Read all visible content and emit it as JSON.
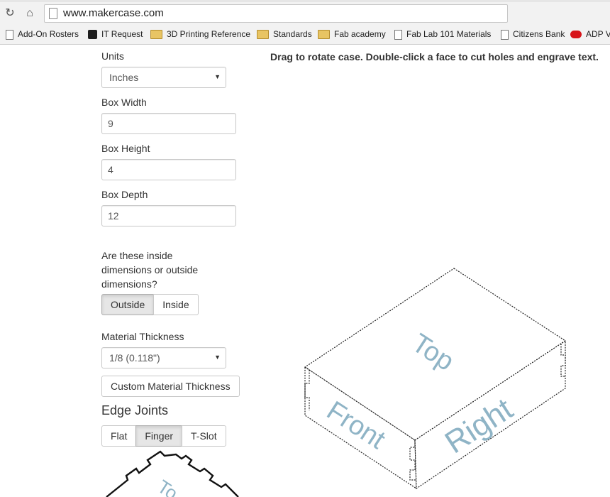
{
  "browser": {
    "url": "www.makercase.com",
    "bookmarks": [
      {
        "label": "Add-On Rosters",
        "icon": "page-icon"
      },
      {
        "label": "IT Request",
        "icon": "it-icon"
      },
      {
        "label": "3D Printing Reference",
        "icon": "folder-icon"
      },
      {
        "label": "Standards",
        "icon": "folder-icon"
      },
      {
        "label": "Fab academy",
        "icon": "folder-icon"
      },
      {
        "label": "Fab Lab 101 Materials",
        "icon": "page-icon"
      },
      {
        "label": "Citizens Bank",
        "icon": "page-icon"
      },
      {
        "label": "ADP Vi",
        "icon": "adp-icon"
      }
    ]
  },
  "form": {
    "units_label": "Units",
    "units_value": "Inches",
    "width_label": "Box Width",
    "width_value": "9",
    "height_label": "Box Height",
    "height_value": "4",
    "depth_label": "Box Depth",
    "depth_value": "12",
    "dimensions_question": "Are these inside dimensions or outside dimensions?",
    "outside_label": "Outside",
    "inside_label": "Inside",
    "selected_dimension": "Outside",
    "thickness_label": "Material Thickness",
    "thickness_value": "1/8 (0.118\")",
    "custom_thickness_label": "Custom Material Thickness",
    "edge_joints_heading": "Edge Joints",
    "joint_flat_label": "Flat",
    "joint_finger_label": "Finger",
    "joint_tslot_label": "T-Slot",
    "selected_joint": "Finger"
  },
  "preview": {
    "instructions": "Drag to rotate case. Double-click a face to cut holes and engrave text.",
    "face_top": "Top",
    "face_front": "Front",
    "face_right": "Right",
    "thumbnail_text": "To",
    "face_label_color": "#8fb4c6"
  }
}
